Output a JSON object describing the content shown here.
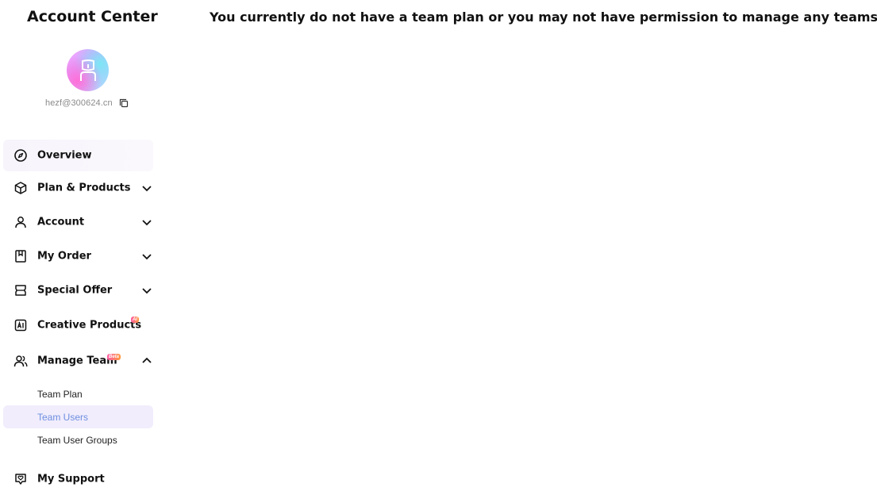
{
  "sidebar": {
    "title": "Account Center",
    "user": {
      "email": "hezf@300624.cn",
      "avatar_icon": "user-avatar-icon"
    },
    "items": [
      {
        "label": "Overview",
        "icon": "compass-icon",
        "has_chevron": false
      },
      {
        "label": "Plan & Products",
        "icon": "box-icon",
        "has_chevron": true,
        "expanded": false
      },
      {
        "label": "Account",
        "icon": "user-icon",
        "has_chevron": true,
        "expanded": false
      },
      {
        "label": "My Order",
        "icon": "bookmark-icon",
        "has_chevron": true,
        "expanded": false
      },
      {
        "label": "Special Offer",
        "icon": "ticket-icon",
        "has_chevron": true,
        "expanded": false
      },
      {
        "label": "Creative Products",
        "icon": "ai-icon",
        "has_chevron": false,
        "badge": "AI"
      },
      {
        "label": "Manage Team",
        "icon": "team-icon",
        "has_chevron": true,
        "expanded": true,
        "badge": "Beta"
      },
      {
        "label": "My Support",
        "icon": "support-heart-icon",
        "has_chevron": false
      }
    ],
    "manage_team_sub": [
      {
        "label": "Team Plan",
        "selected": false
      },
      {
        "label": "Team Users",
        "selected": true
      },
      {
        "label": "Team User Groups",
        "selected": false
      }
    ]
  },
  "main": {
    "message": "You currently do not have a team plan or you may not have permission to manage any teams."
  },
  "colors": {
    "selected_text": "#6e8ee0",
    "selected_bg": "#f1edfc",
    "badge_gradient_start": "#ff5aa5",
    "badge_gradient_end": "#ff9a3d"
  }
}
